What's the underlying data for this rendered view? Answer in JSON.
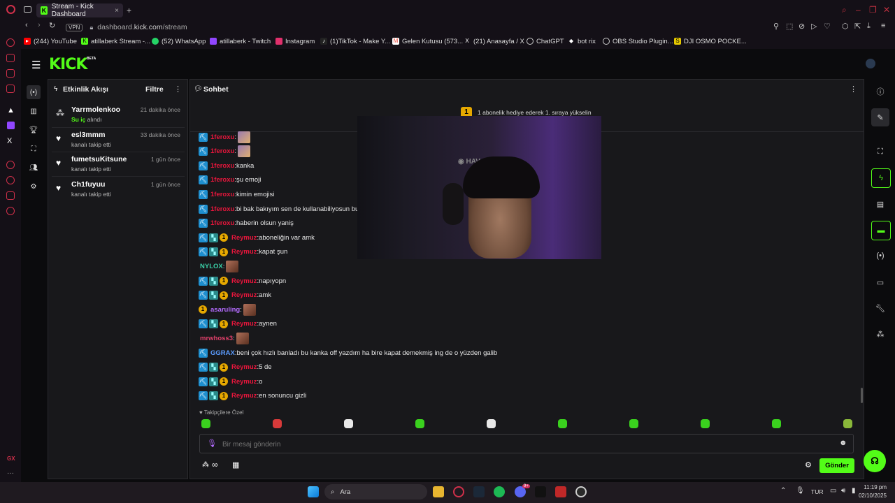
{
  "browser": {
    "tab_title": "Stream - Kick Dashboard",
    "tab_favicon": "K",
    "new_tab": "+",
    "vpn_label": "VPN",
    "url_prefix": "dashboard.",
    "url_host": "kick.com",
    "url_path": "/stream",
    "bookmarks": [
      {
        "label": "(244) YouTube",
        "color": "#ff0000"
      },
      {
        "label": "atillaberk Stream -...",
        "color": "#53fc18"
      },
      {
        "label": "(52) WhatsApp",
        "color": "#25d366"
      },
      {
        "label": "atillaberk - Twitch",
        "color": "#9146ff"
      },
      {
        "label": "Instagram",
        "color": "#e1306c"
      },
      {
        "label": "(1)TikTok - Make Y...",
        "color": "#222222"
      },
      {
        "label": "Gelen Kutusu (573...",
        "color": "#ea4335"
      },
      {
        "label": "(21) Anasayfa / X",
        "color": "#222222"
      },
      {
        "label": "ChatGPT",
        "color": "#444444"
      },
      {
        "label": "bot rix",
        "color": "#333333"
      },
      {
        "label": "OBS Studio Plugin...",
        "color": "#333333"
      },
      {
        "label": "DJI OSMO POCKE...",
        "color": "#e6c800"
      }
    ]
  },
  "kick": {
    "logo": "KICK",
    "beta": "BETA",
    "activity": {
      "title": "Etkinlik Akışı",
      "filter_label": "Filtre",
      "events": [
        {
          "name": "Yarrmolenkoo",
          "time": "21 dakika önce",
          "highlight": "Su iç",
          "detail": " alındı",
          "icon": "redeem-icon"
        },
        {
          "name": "esl3mmm",
          "time": "33 dakika önce",
          "highlight": "",
          "detail": "kanalı takip etti",
          "icon": "heart-icon"
        },
        {
          "name": "fumetsuKitsune",
          "time": "1 gün önce",
          "highlight": "",
          "detail": "kanalı takip etti",
          "icon": "heart-icon"
        },
        {
          "name": "Ch1fuyuu",
          "time": "1 gün önce",
          "highlight": "",
          "detail": "kanalı takip etti",
          "icon": "heart-icon"
        }
      ]
    },
    "chat": {
      "title": "Sohbet",
      "sub_banner_badge": "1",
      "sub_banner": "1 abonelik hediye ederek 1. sıraya yükselin",
      "messages": [
        {
          "user": "1feroxu",
          "color": "#e8163c",
          "text": "",
          "badges": [
            "pick"
          ],
          "emote": "a"
        },
        {
          "user": "1feroxu",
          "color": "#e8163c",
          "text": "",
          "badges": [
            "pick"
          ],
          "emote": "a"
        },
        {
          "user": "1feroxu",
          "color": "#e8163c",
          "text": "kanka",
          "badges": [
            "pick"
          ],
          "emote": ""
        },
        {
          "user": "1feroxu",
          "color": "#e8163c",
          "text": "şu emoji",
          "badges": [
            "pick"
          ],
          "emote": ""
        },
        {
          "user": "1feroxu",
          "color": "#e8163c",
          "text": "kimin emojisi",
          "badges": [
            "pick"
          ],
          "emote": ""
        },
        {
          "user": "1feroxu",
          "color": "#e8163c",
          "text": "bi bak bakıyım sen de kullanabiliyosun bu e",
          "badges": [
            "pick"
          ],
          "emote": ""
        },
        {
          "user": "1feroxu",
          "color": "#e8163c",
          "text": "haberin olsun yaniş",
          "badges": [
            "pick"
          ],
          "emote": ""
        },
        {
          "user": "Reymuz",
          "color": "#e8163c",
          "text": "aboneliğin var amk",
          "badges": [
            "pick",
            "sub",
            "gift"
          ],
          "emote": ""
        },
        {
          "user": "Reymuz",
          "color": "#e8163c",
          "text": "kapat şun",
          "badges": [
            "pick",
            "sub",
            "gift"
          ],
          "emote": ""
        },
        {
          "user": "NYLOX",
          "color": "#3ad1a8",
          "text": "",
          "badges": [],
          "emote": "b"
        },
        {
          "user": "Reymuz",
          "color": "#e8163c",
          "text": "napıyopn",
          "badges": [
            "pick",
            "sub",
            "gift"
          ],
          "emote": ""
        },
        {
          "user": "Reymuz",
          "color": "#e8163c",
          "text": "amk",
          "badges": [
            "pick",
            "sub",
            "gift"
          ],
          "emote": ""
        },
        {
          "user": "asaruling",
          "color": "#b46cff",
          "text": "",
          "badges": [
            "gift"
          ],
          "emote": "b"
        },
        {
          "user": "Reymuz",
          "color": "#e8163c",
          "text": "aynen",
          "badges": [
            "pick",
            "sub",
            "gift"
          ],
          "emote": ""
        },
        {
          "user": "mrwhoss3",
          "color": "#e0406a",
          "text": "",
          "badges": [],
          "emote": "b"
        },
        {
          "user": "GGRAX",
          "color": "#5b9cff",
          "text": "beni çok hızlı banladı bu kanka off yazdım ha bire kapat demekmiş ing de o yüzden galib",
          "badges": [
            "pick"
          ],
          "emote": ""
        },
        {
          "user": "Reymuz",
          "color": "#e8163c",
          "text": "5 de",
          "badges": [
            "pick",
            "sub",
            "gift"
          ],
          "emote": ""
        },
        {
          "user": "Reymuz",
          "color": "#e8163c",
          "text": "o",
          "badges": [
            "pick",
            "sub",
            "gift"
          ],
          "emote": ""
        },
        {
          "user": "Reymuz",
          "color": "#e8163c",
          "text": "en sonuncu gizli",
          "badges": [
            "pick",
            "sub",
            "gift"
          ],
          "emote": ""
        }
      ],
      "follower_only_label": "Takipçilere Özel",
      "input_placeholder": "Bir mesaj gönderin",
      "send_label": "Gönder",
      "points_label": "∞"
    },
    "accent": "#53fc18"
  },
  "taskbar": {
    "search_label": "Ara",
    "language": "TUR",
    "time": "11:19 pm",
    "date": "02/10/2025",
    "discord_badge": "9+"
  }
}
